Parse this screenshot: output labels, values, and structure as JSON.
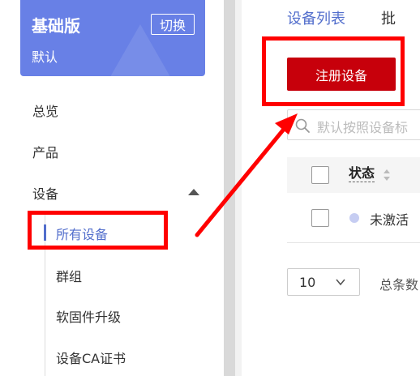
{
  "sidebar": {
    "edition": {
      "name": "基础版",
      "switch_label": "切换",
      "instance": "默认"
    },
    "items": [
      {
        "label": "总览"
      },
      {
        "label": "产品"
      },
      {
        "label": "设备"
      }
    ],
    "device_subitems": [
      {
        "label": "所有设备",
        "active": true
      },
      {
        "label": "群组"
      },
      {
        "label": "软固件升级"
      },
      {
        "label": "设备CA证书"
      }
    ]
  },
  "main": {
    "tabs": [
      {
        "label": "设备列表",
        "active": true
      },
      {
        "label": "批"
      }
    ],
    "register_button": "注册设备",
    "search": {
      "placeholder": "默认按照设备标"
    },
    "table": {
      "columns": [
        {
          "label": "状态"
        }
      ],
      "rows": [
        {
          "status": "未激活"
        }
      ]
    },
    "pagination": {
      "page_size": "10",
      "total_label": "总条数"
    }
  },
  "colors": {
    "edition_bg": "#6880e6",
    "accent": "#526ecc",
    "register_bg": "#c7000b",
    "annotation": "#ff0000"
  }
}
